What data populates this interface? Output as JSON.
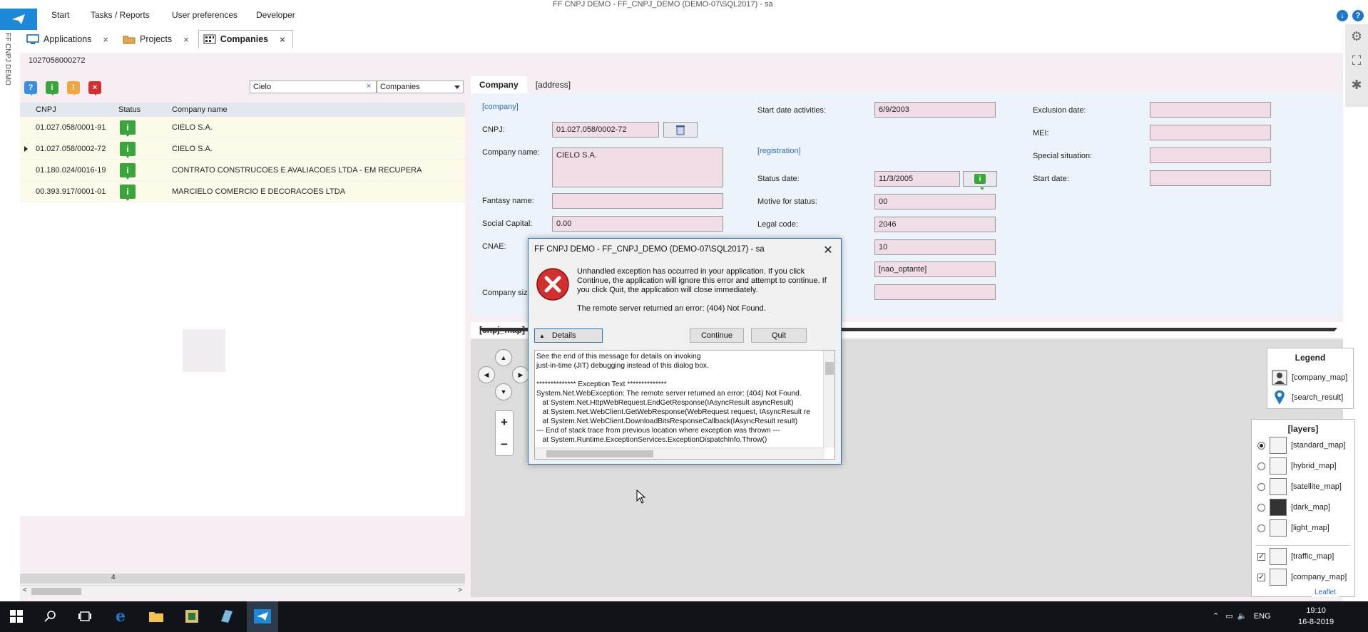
{
  "window_title": "FF CNPJ DEMO - FF_CNPJ_DEMO (DEMO-07\\SQL2017) - sa",
  "app_label": "FF CNPJ DEMO",
  "menu": [
    "Start",
    "Tasks / Reports",
    "User preferences",
    "Developer"
  ],
  "tabs": [
    {
      "label": "Applications",
      "icon": "monitor-icon",
      "active": false
    },
    {
      "label": "Projects",
      "icon": "folder-icon",
      "active": false
    },
    {
      "label": "Companies",
      "icon": "building-icon",
      "active": true
    }
  ],
  "record_id": "1027058000272",
  "search": {
    "value": "Cielo",
    "clear": "×",
    "scope": "Companies"
  },
  "grid": {
    "headers": [
      "CNPJ",
      "Status",
      "Company name"
    ],
    "rows": [
      {
        "cnpj": "01.027.058/0001-91",
        "status": "i",
        "name": "CIELO S.A.",
        "selected": false
      },
      {
        "cnpj": "01.027.058/0002-72",
        "status": "i",
        "name": "CIELO S.A.",
        "selected": true
      },
      {
        "cnpj": "01.180.024/0016-19",
        "status": "i",
        "name": "CONTRATO CONSTRUCOES E AVALIACOES LTDA - EM RECUPERA",
        "selected": false
      },
      {
        "cnpj": "00.393.917/0001-01",
        "status": "i",
        "name": "MARCIELO COMERCIO E DECORACOES LTDA",
        "selected": false
      }
    ],
    "count": "4"
  },
  "form": {
    "tabs": [
      "Company",
      "[address]"
    ],
    "links": {
      "company": "[company]",
      "registration": "[registration]"
    },
    "labels": {
      "cnpj": "CNPJ:",
      "company_name": "Company name:",
      "fantasy_name": "Fantasy name:",
      "social_capital": "Social Capital:",
      "cnae": "CNAE:",
      "company_size": "Company siz",
      "start_date_activities": "Start date activities:",
      "status_date": "Status date:",
      "motive": "Motive for status:",
      "legal_code": "Legal code:",
      "exclusion_date": "Exclusion date:",
      "mei": "MEI:",
      "special_situation": "Special situation:",
      "start_date": "Start date:"
    },
    "values": {
      "cnpj": "01.027.058/0002-72",
      "company_name": "CIELO S.A.",
      "fantasy_name": "",
      "social_capital": "0.00",
      "start_date_activities": "6/9/2003",
      "status_date": "11/3/2005",
      "motive": "00",
      "legal_code": "2046",
      "field_10": "10",
      "nao_optante": "[nao_optante]",
      "blank": ""
    }
  },
  "map": {
    "title": "[cnpj_map]",
    "legend": {
      "title": "Legend",
      "items": [
        "[company_map]",
        "[search_result]"
      ]
    },
    "layers": {
      "title": "[layers]",
      "base": [
        {
          "label": "[standard_map]",
          "selected": true
        },
        {
          "label": "[hybrid_map]",
          "selected": false
        },
        {
          "label": "[satellite_map]",
          "selected": false
        },
        {
          "label": "[dark_map]",
          "selected": false
        },
        {
          "label": "[light_map]",
          "selected": false
        }
      ],
      "overlays": [
        {
          "label": "[traffic_map]",
          "checked": true
        },
        {
          "label": "[company_map]",
          "checked": true
        }
      ]
    },
    "attribution": "Leaflet",
    "zoom_in": "+",
    "zoom_out": "−"
  },
  "dialog": {
    "title": "FF CNPJ DEMO - FF_CNPJ_DEMO (DEMO-07\\SQL2017) - sa",
    "message": "Unhandled exception has occurred in your application. If you click Continue, the application will ignore this error and attempt to continue. If you click Quit, the application will close immediately.",
    "error": "The remote server returned an error: (404) Not Found.",
    "details_label": "Details",
    "continue_label": "Continue",
    "quit_label": "Quit",
    "details_text": "See the end of this message for details on invoking\njust-in-time (JIT) debugging instead of this dialog box.\n\n************** Exception Text **************\nSystem.Net.WebException: The remote server returned an error: (404) Not Found.\n   at System.Net.HttpWebRequest.EndGetResponse(IAsyncResult asyncResult)\n   at System.Net.WebClient.GetWebResponse(WebRequest request, IAsyncResult re\n   at System.Net.WebClient.DownloadBitsResponseCallback(IAsyncResult result)\n--- End of stack trace from previous location where exception was thrown ---\n   at System.Runtime.ExceptionServices.ExceptionDispatchInfo.Throw()"
  },
  "taskbar": {
    "lang": "ENG",
    "time": "19:10",
    "date": "16-8-2019"
  },
  "colors": {
    "accent": "#1e88d8",
    "status_green": "#3aa53a",
    "field_bg": "#f0dde6",
    "error_red": "#d32f2f"
  }
}
